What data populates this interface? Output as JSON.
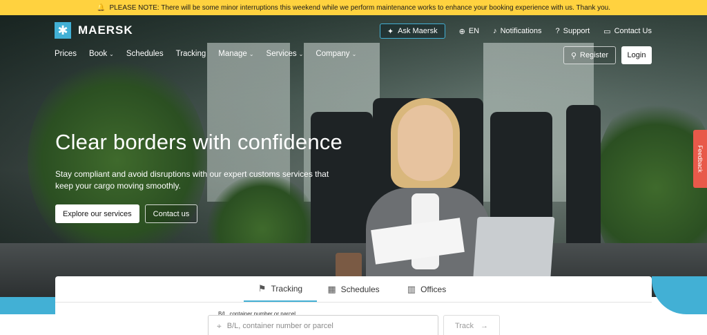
{
  "notice": {
    "text": "PLEASE NOTE: There will be some minor interruptions this weekend while we perform maintenance works to enhance your booking experience with us. Thank you.",
    "icon": "bell-icon"
  },
  "brand": {
    "name": "MAERSK",
    "star": "✱"
  },
  "topnav": {
    "ask": "Ask Maersk",
    "lang": "EN",
    "notifications": "Notifications",
    "support": "Support",
    "contact": "Contact Us"
  },
  "mainnav": {
    "items": [
      {
        "label": "Prices",
        "dropdown": false
      },
      {
        "label": "Book",
        "dropdown": true
      },
      {
        "label": "Schedules",
        "dropdown": false
      },
      {
        "label": "Tracking",
        "dropdown": false
      },
      {
        "label": "Manage",
        "dropdown": true
      },
      {
        "label": "Services",
        "dropdown": true
      },
      {
        "label": "Company",
        "dropdown": true
      }
    ]
  },
  "auth": {
    "register": "Register",
    "login": "Login"
  },
  "hero": {
    "title": "Clear borders with confidence",
    "subtitle": "Stay compliant and avoid disruptions with our expert customs services that keep your cargo moving smoothly.",
    "primary_cta": "Explore our services",
    "secondary_cta": "Contact us"
  },
  "feedback": "Feedback",
  "panel": {
    "tabs": [
      {
        "label": "Tracking",
        "icon": "tracking-icon",
        "active": true
      },
      {
        "label": "Schedules",
        "icon": "calendar-icon",
        "active": false
      },
      {
        "label": "Offices",
        "icon": "building-icon",
        "active": false
      }
    ],
    "field_label": "B/L, container number or parcel",
    "field_placeholder": "B/L, container number or parcel",
    "track_label": "Track"
  },
  "colors": {
    "accent": "#42b0d5",
    "notice": "#ffd23f",
    "feedback": "#e8594a"
  }
}
